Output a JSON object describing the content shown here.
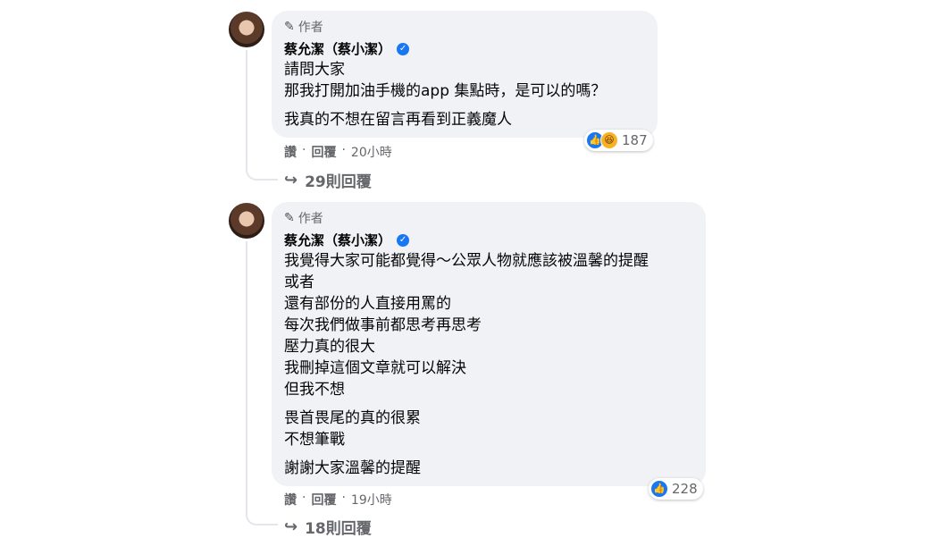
{
  "comments": [
    {
      "author_tag": "作者",
      "name": "蔡允潔（蔡小潔）",
      "paragraphs": [
        [
          "請問大家",
          "那我打開加油手機的app 集點時，是可以的嗎？"
        ],
        [
          "我真的不想在留言再看到正義魔人"
        ]
      ],
      "actions": {
        "like": "讚",
        "reply": "回覆",
        "time": "20小時"
      },
      "reaction_count": "187",
      "replies_label": "29則回覆"
    },
    {
      "author_tag": "作者",
      "name": "蔡允潔（蔡小潔）",
      "paragraphs": [
        [
          "我覺得大家可能都覺得～公眾人物就應該被溫馨的提醒",
          "或者",
          "還有部份的人直接用罵的",
          "每次我們做事前都思考再思考",
          "壓力真的很大",
          "我刪掉這個文章就可以解決",
          "但我不想"
        ],
        [
          "畏首畏尾的真的很累",
          "不想筆戰"
        ],
        [
          "謝謝大家溫馨的提醒"
        ]
      ],
      "actions": {
        "like": "讚",
        "reply": "回覆",
        "time": "19小時"
      },
      "reaction_count": "228",
      "replies_label": "18則回覆"
    }
  ]
}
